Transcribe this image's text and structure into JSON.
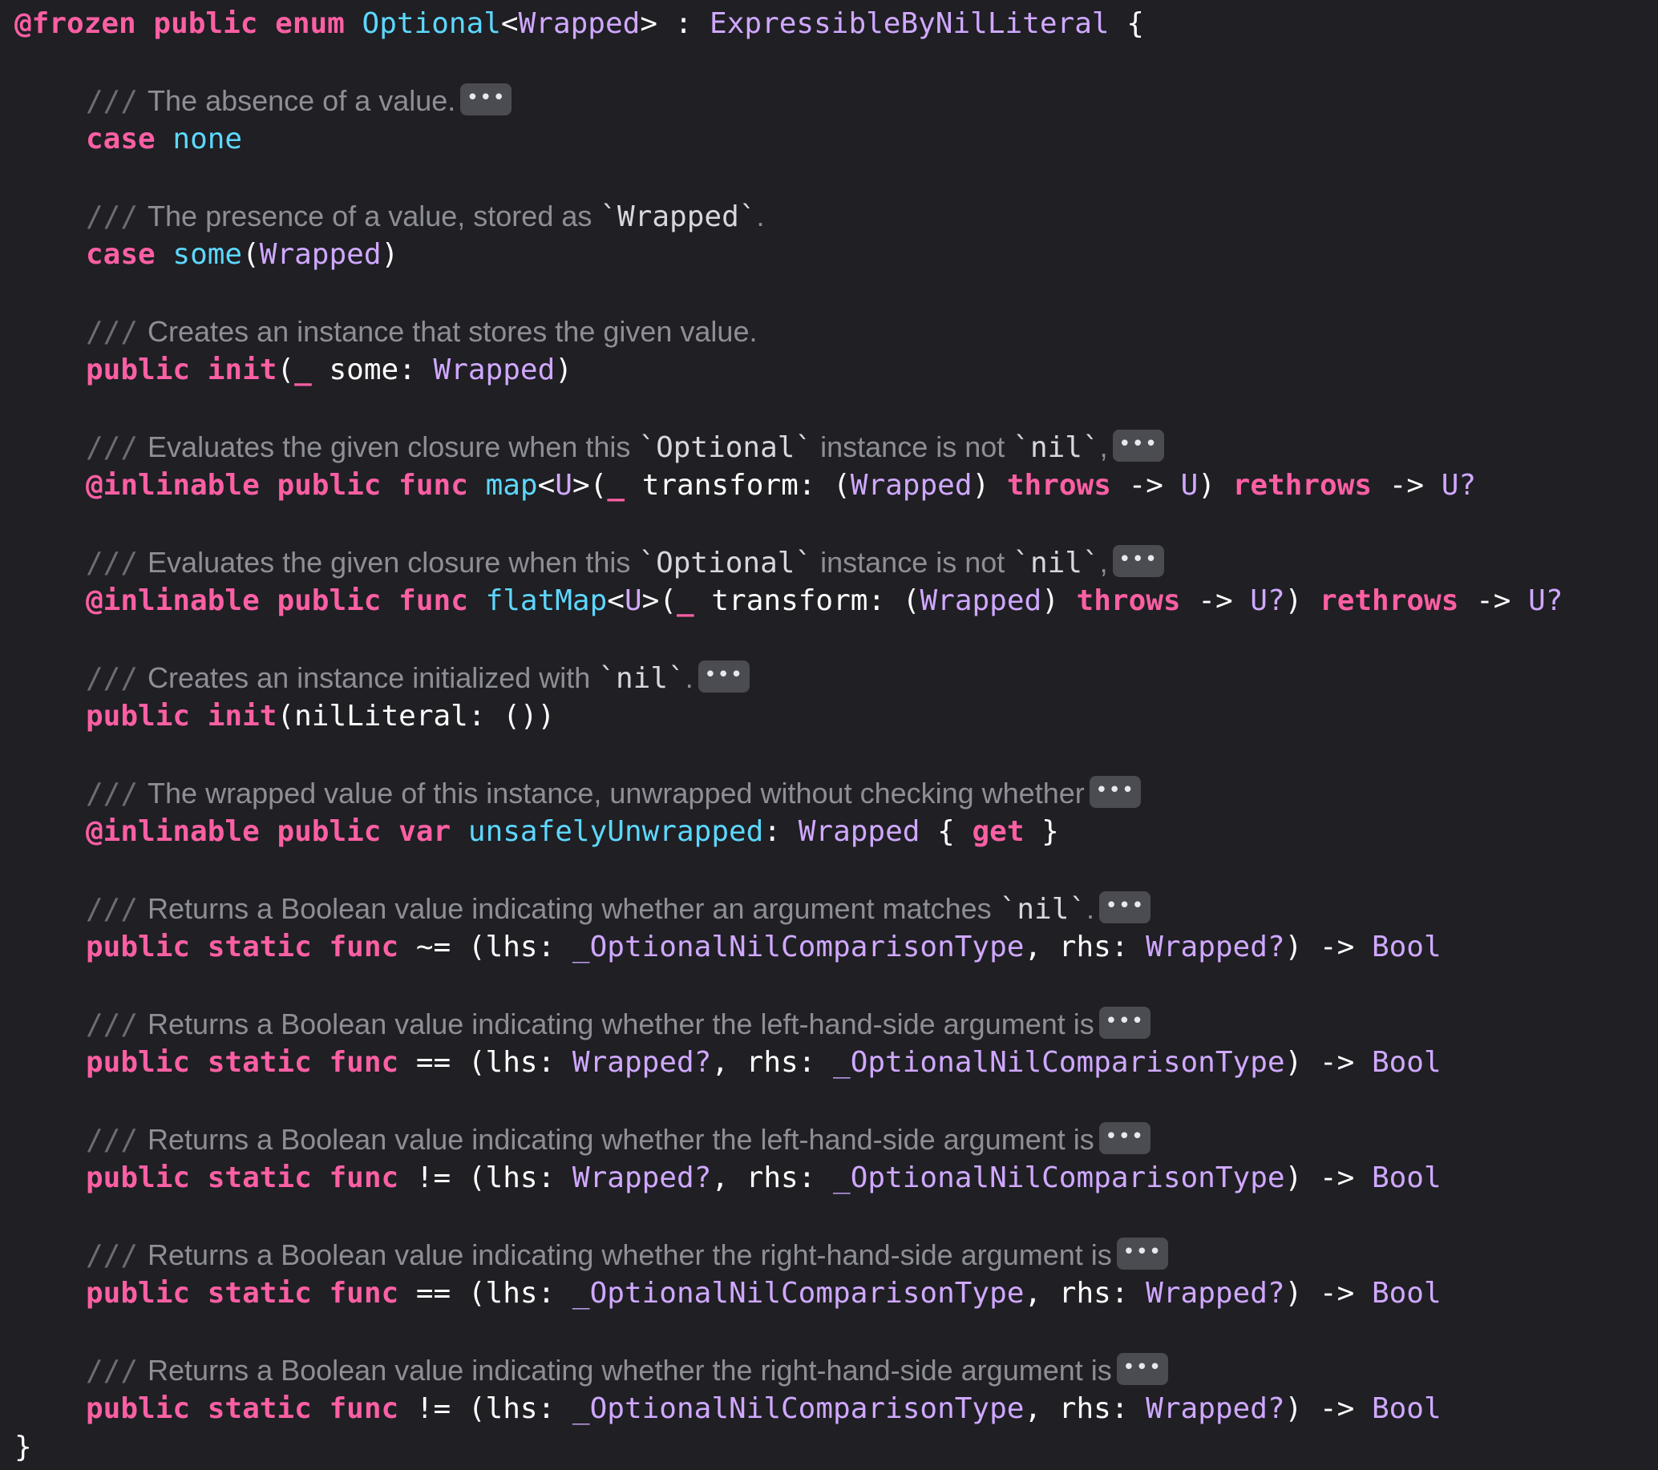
{
  "header": {
    "frozen": "@frozen",
    "public": "public",
    "enum": "enum",
    "name": "Optional",
    "generic_open": "<",
    "generic_param": "Wrapped",
    "generic_close": ">",
    "colon": " : ",
    "protocol": "ExpressibleByNilLiteral",
    "brace": " {"
  },
  "closing_brace": "}",
  "fold_glyph": "•••",
  "comment_marker": "///",
  "items": [
    {
      "comment": "The absence of a value.",
      "code": {
        "kw1": "case",
        "name": "none"
      }
    },
    {
      "comment_pre": "The presence of a value, stored as ",
      "comment_code": "`Wrapped`",
      "comment_post": ".",
      "code": {
        "kw1": "case",
        "name": "some",
        "open": "(",
        "type": "Wrapped",
        "close": ")"
      }
    },
    {
      "comment": "Creates an instance that stores the given value.",
      "code": {
        "kw1": "public",
        "kw2": "init",
        "open": "(",
        "underscore": "_",
        "param": " some: ",
        "type": "Wrapped",
        "close": ")"
      }
    },
    {
      "comment_pre": "Evaluates the given closure when this ",
      "comment_code": "`Optional`",
      "comment_mid": " instance is not ",
      "comment_code2": "`nil`",
      "comment_post": ",",
      "code": {
        "attr": "@inlinable",
        "kw1": "public",
        "kw2": "func",
        "name": "map",
        "generic_open": "<",
        "generic": "U",
        "generic_close": ">(",
        "underscore": "_",
        "param": " transform: (",
        "type": "Wrapped",
        "close": ") ",
        "throws": "throws",
        "arrow1": " -> ",
        "ret1": "U",
        "close2": ") ",
        "rethrows": "rethrows",
        "arrow2": " -> ",
        "ret2": "U?"
      }
    },
    {
      "comment_pre": "Evaluates the given closure when this ",
      "comment_code": "`Optional`",
      "comment_mid": " instance is not ",
      "comment_code2": "`nil`",
      "comment_post": ",",
      "code": {
        "attr": "@inlinable",
        "kw1": "public",
        "kw2": "func",
        "name": "flatMap",
        "generic_open": "<",
        "generic": "U",
        "generic_close": ">(",
        "underscore": "_",
        "param": " transform: (",
        "type": "Wrapped",
        "close": ") ",
        "throws": "throws",
        "arrow1": " -> ",
        "ret1": "U?",
        "close2": ") ",
        "rethrows": "rethrows",
        "arrow2": " -> ",
        "ret2": "U?"
      }
    },
    {
      "comment_pre": "Creates an instance initialized with ",
      "comment_code": "`nil`",
      "comment_post": ".",
      "code": {
        "kw1": "public",
        "kw2": "init",
        "rest": "(nilLiteral: ())"
      }
    },
    {
      "comment": "The wrapped value of this instance, unwrapped without checking whether",
      "code": {
        "attr": "@inlinable",
        "kw1": "public",
        "kw2": "var",
        "name": "unsafelyUnwrapped",
        "colon": ": ",
        "type": "Wrapped",
        "open": " { ",
        "get": "get",
        "close": " }"
      }
    },
    {
      "comment_pre": "Returns a Boolean value indicating whether an argument matches ",
      "comment_code": "`nil`",
      "comment_post": ".",
      "code": {
        "kw1": "public",
        "kw2": "static",
        "kw3": "func",
        "op": " ~= (lhs: ",
        "t1": "_OptionalNilComparisonType",
        "mid": ", rhs: ",
        "t2": "Wrapped?",
        "arrow": ") -> ",
        "ret": "Bool"
      }
    },
    {
      "comment": "Returns a Boolean value indicating whether the left-hand-side argument is",
      "code": {
        "kw1": "public",
        "kw2": "static",
        "kw3": "func",
        "op": " == (lhs: ",
        "t1": "Wrapped?",
        "mid": ", rhs: ",
        "t2": "_OptionalNilComparisonType",
        "arrow": ") -> ",
        "ret": "Bool"
      }
    },
    {
      "comment": "Returns a Boolean value indicating whether the left-hand-side argument is",
      "code": {
        "kw1": "public",
        "kw2": "static",
        "kw3": "func",
        "op": " != (lhs: ",
        "t1": "Wrapped?",
        "mid": ", rhs: ",
        "t2": "_OptionalNilComparisonType",
        "arrow": ") -> ",
        "ret": "Bool"
      }
    },
    {
      "comment": "Returns a Boolean value indicating whether the right-hand-side argument is",
      "code": {
        "kw1": "public",
        "kw2": "static",
        "kw3": "func",
        "op": " == (lhs: ",
        "t1": "_OptionalNilComparisonType",
        "mid": ", rhs: ",
        "t2": "Wrapped?",
        "arrow": ") -> ",
        "ret": "Bool"
      }
    },
    {
      "comment": "Returns a Boolean value indicating whether the right-hand-side argument is",
      "code": {
        "kw1": "public",
        "kw2": "static",
        "kw3": "func",
        "op": " != (lhs: ",
        "t1": "_OptionalNilComparisonType",
        "mid": ", rhs: ",
        "t2": "Wrapped?",
        "arrow": ") -> ",
        "ret": "Bool"
      }
    }
  ]
}
